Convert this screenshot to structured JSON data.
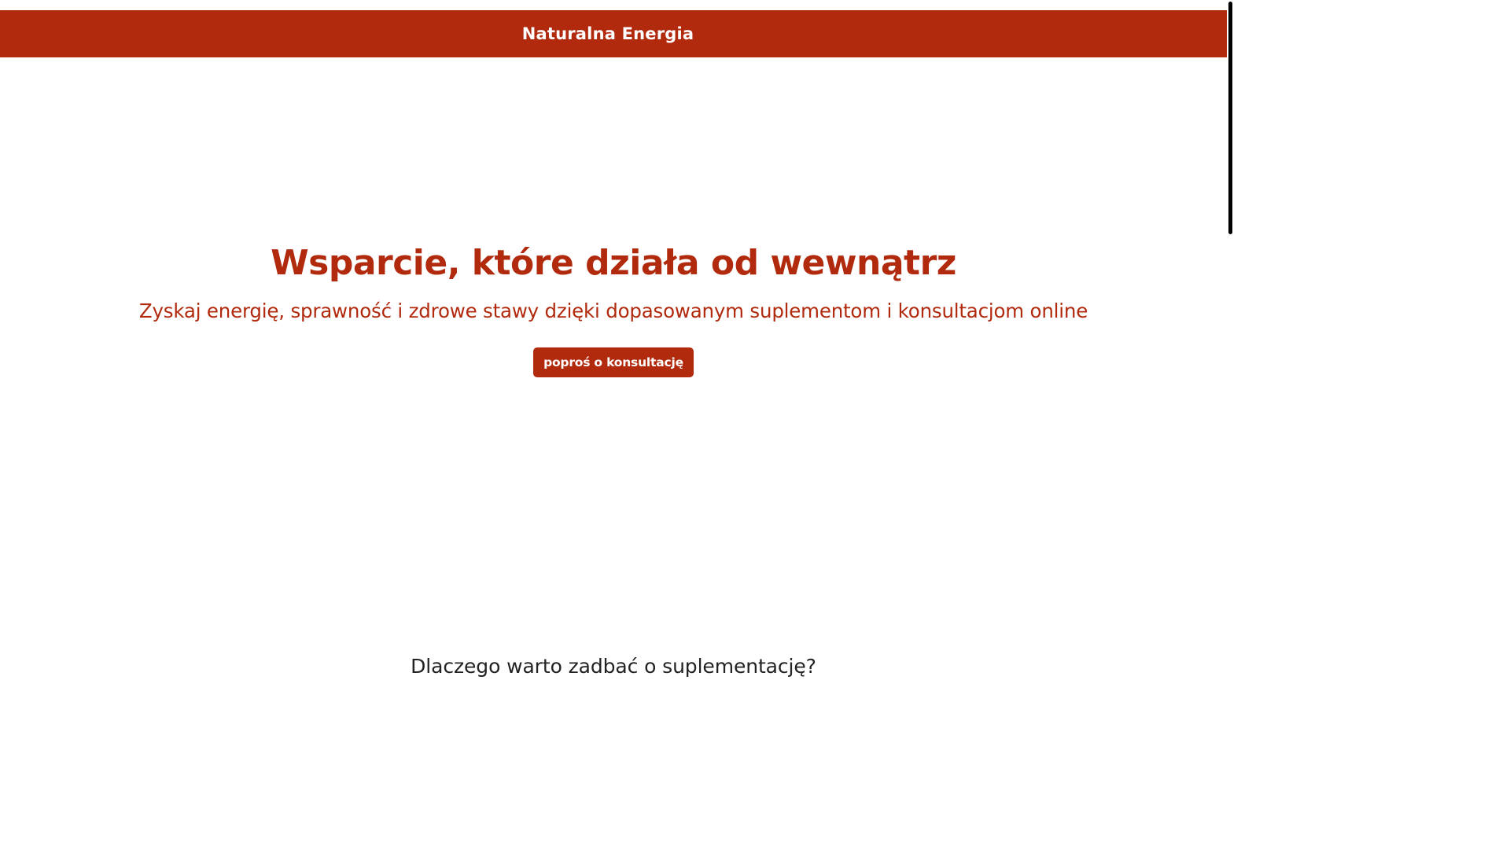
{
  "header": {
    "brand": "Naturalna Energia"
  },
  "hero": {
    "title": "Wsparcie, które działa od wewnątrz",
    "subtitle": "Zyskaj energię, sprawność i zdrowe stawy dzięki dopasowanym suplementom i konsultacjom online",
    "cta_label": "poproś o konsultację"
  },
  "sections": {
    "why_title": "Dlaczego warto zadbać o suplementację?"
  },
  "colors": {
    "brand": "#b22a0e",
    "text_dark": "#222222",
    "background": "#ffffff"
  }
}
